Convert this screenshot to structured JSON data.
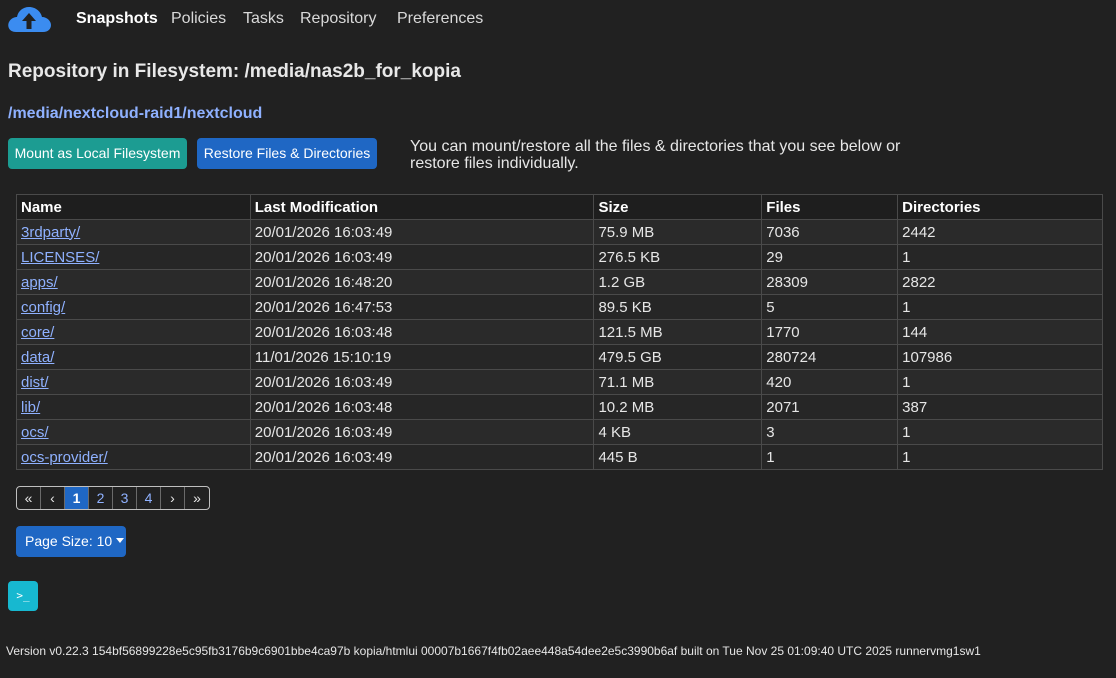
{
  "nav": {
    "logo_icon": "kopia-cloud-logo",
    "items": [
      {
        "label": "Snapshots",
        "active": true
      },
      {
        "label": "Policies",
        "active": false
      },
      {
        "label": "Tasks",
        "active": false
      },
      {
        "label": "Repository",
        "active": false
      },
      {
        "label": "Preferences",
        "active": false
      }
    ]
  },
  "repo_title": "Repository in Filesystem: /media/nas2b_for_kopia",
  "source_path": "/media/nextcloud-raid1/nextcloud",
  "buttons": {
    "mount": "Mount as Local Filesystem",
    "restore": "Restore Files & Directories"
  },
  "help_text": "You can mount/restore all the files & directories that you see below or restore files individually.",
  "table": {
    "headers": [
      "Name",
      "Last Modification",
      "Size",
      "Files",
      "Directories"
    ],
    "rows": [
      {
        "name": "3rdparty/",
        "modified": "20/01/2026 16:03:49",
        "size": "75.9 MB",
        "files": "7036",
        "dirs": "2442"
      },
      {
        "name": "LICENSES/",
        "modified": "20/01/2026 16:03:49",
        "size": "276.5 KB",
        "files": "29",
        "dirs": "1"
      },
      {
        "name": "apps/",
        "modified": "20/01/2026 16:48:20",
        "size": "1.2 GB",
        "files": "28309",
        "dirs": "2822"
      },
      {
        "name": "config/",
        "modified": "20/01/2026 16:47:53",
        "size": "89.5 KB",
        "files": "5",
        "dirs": "1"
      },
      {
        "name": "core/",
        "modified": "20/01/2026 16:03:48",
        "size": "121.5 MB",
        "files": "1770",
        "dirs": "144"
      },
      {
        "name": "data/",
        "modified": "11/01/2026 15:10:19",
        "size": "479.5 GB",
        "files": "280724",
        "dirs": "107986"
      },
      {
        "name": "dist/",
        "modified": "20/01/2026 16:03:49",
        "size": "71.1 MB",
        "files": "420",
        "dirs": "1"
      },
      {
        "name": "lib/",
        "modified": "20/01/2026 16:03:48",
        "size": "10.2 MB",
        "files": "2071",
        "dirs": "387"
      },
      {
        "name": "ocs/",
        "modified": "20/01/2026 16:03:49",
        "size": "4 KB",
        "files": "3",
        "dirs": "1"
      },
      {
        "name": "ocs-provider/",
        "modified": "20/01/2026 16:03:49",
        "size": "445 B",
        "files": "1",
        "dirs": "1"
      }
    ]
  },
  "pagination": {
    "first": "«",
    "prev": "‹",
    "pages": [
      "1",
      "2",
      "3",
      "4"
    ],
    "current": "1",
    "next": "›",
    "last": "»"
  },
  "page_size_label": "Page Size: 10",
  "terminal_icon": "terminal-icon",
  "terminal_glyph": ">_",
  "version": "Version v0.22.3 154bf56899228e5c95fb3176b9c6901bbe4ca97b kopia/htmlui 00007b1667f4fb02aee448a54dee2e5c3990b6af built on Tue Nov 25 01:09:40 UTC 2025 runnervmg1sw1",
  "colors": {
    "accent": "#1f67c4",
    "teal": "#1c9c92",
    "link": "#8fb1ff",
    "terminal": "#17b8d0"
  }
}
